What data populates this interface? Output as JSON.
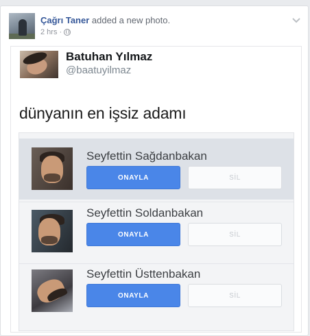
{
  "post": {
    "author_name": "Çağrı Taner",
    "action_text": "added a new photo.",
    "time": "2 hrs",
    "separator": "·"
  },
  "tweet": {
    "name": "Batuhan Yılmaz",
    "handle": "@baatuyilmaz",
    "text": "dünyanın en işsiz adamı"
  },
  "requests": [
    {
      "name": "Seyfettin Sağdanbakan",
      "approve_label": "ONAYLA",
      "delete_label": "SİL"
    },
    {
      "name": "Seyfettin Soldanbakan",
      "approve_label": "ONAYLA",
      "delete_label": "SİL"
    },
    {
      "name": "Seyfettin Üsttenbakan",
      "approve_label": "ONAYLA",
      "delete_label": "SİL"
    }
  ],
  "colors": {
    "link": "#365899",
    "approve": "#4a86e8",
    "highlight_row": "#dde1e7"
  },
  "icons": {
    "privacy": "globe-icon",
    "menu": "chevron-down-icon"
  }
}
